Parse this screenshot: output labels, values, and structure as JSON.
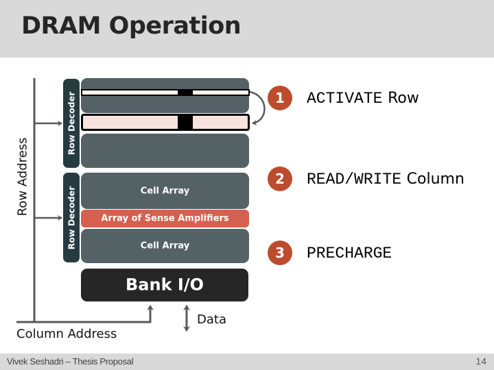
{
  "slide": {
    "title": "DRAM Operation",
    "footer_left": "Vivek Seshadri – Thesis Proposal",
    "page_number": "14"
  },
  "diagram": {
    "row_address_label": "Row Address",
    "column_address_label": "Column Address",
    "data_label": "Data",
    "row_decoder_labels": [
      "Row Decoder",
      "Row Decoder"
    ],
    "cell_array_labels": [
      "Cell Array",
      "Cell Array"
    ],
    "sense_amp_label": "Array of Sense Amplifiers",
    "bank_io_label": "Bank I/O",
    "colors": {
      "decoder": "#263b40",
      "cell_array": "#546165",
      "sense_amplifiers": "#d5604f",
      "bank_io": "#262626",
      "row_buffer_highlight": "#f8e2dd",
      "active_row": "#fdf4ea",
      "step_badge": "#bd4b2d"
    }
  },
  "steps": [
    {
      "number": "1",
      "command": "ACTIVATE",
      "object": "Row"
    },
    {
      "number": "2",
      "command": "READ/WRITE",
      "object": "Column"
    },
    {
      "number": "3",
      "command": "PRECHARGE",
      "object": ""
    }
  ]
}
